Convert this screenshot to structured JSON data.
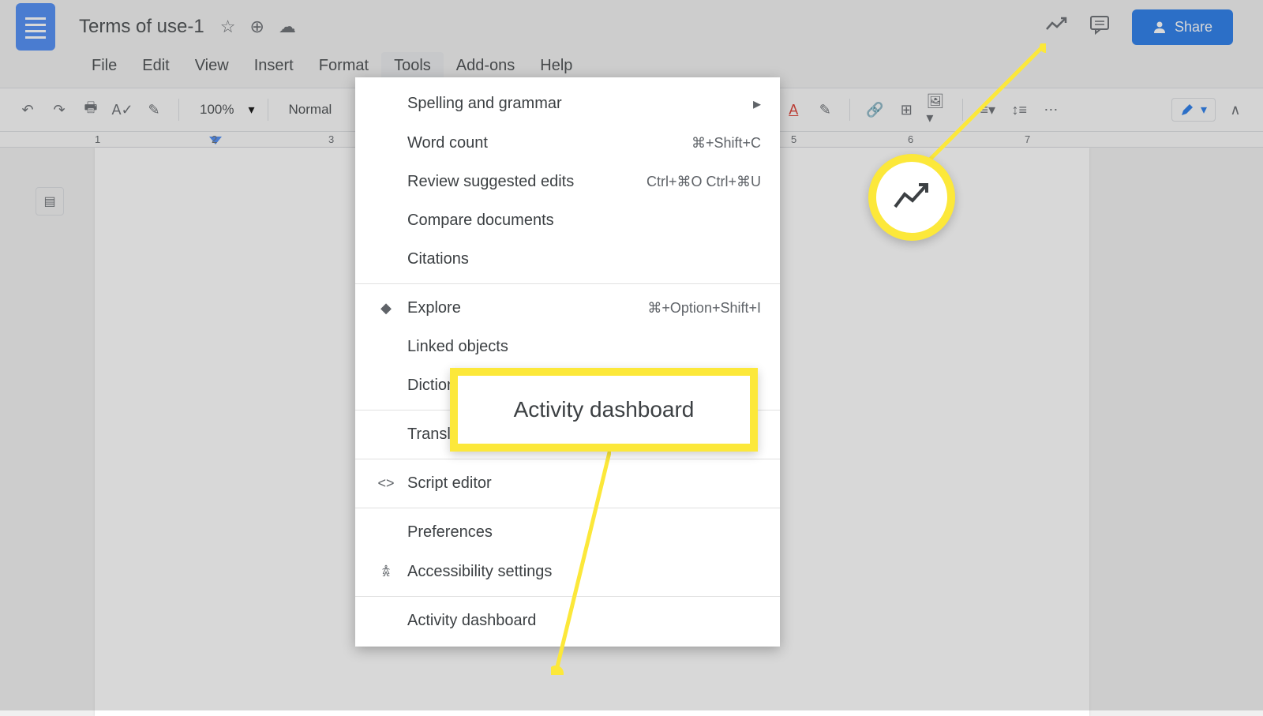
{
  "document": {
    "title": "Terms of use-1"
  },
  "menus": {
    "file": "File",
    "edit": "Edit",
    "view": "View",
    "insert": "Insert",
    "format": "Format",
    "tools": "Tools",
    "addons": "Add-ons",
    "help": "Help"
  },
  "toolbar": {
    "zoom": "100%",
    "style": "Normal"
  },
  "share": {
    "label": "Share"
  },
  "ruler_ticks": [
    "1",
    "2",
    "3",
    "5",
    "6",
    "7"
  ],
  "tools_menu": {
    "spelling": "Spelling and grammar",
    "wordcount": "Word count",
    "wordcount_sc": "⌘+Shift+C",
    "review": "Review suggested edits",
    "review_sc": "Ctrl+⌘O Ctrl+⌘U",
    "compare": "Compare documents",
    "citations": "Citations",
    "explore": "Explore",
    "explore_sc": "⌘+Option+Shift+I",
    "linked": "Linked objects",
    "dictionary": "Diction",
    "translate": "Transl",
    "script": "Script editor",
    "prefs": "Preferences",
    "accessibility": "Accessibility settings",
    "activity": "Activity dashboard"
  },
  "callouts": {
    "activity_label": "Activity dashboard"
  }
}
